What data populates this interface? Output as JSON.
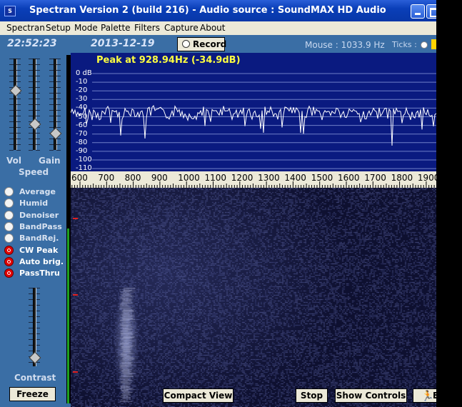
{
  "window": {
    "title": "Spectran Version 2 (build 216) - Audio source  :  SoundMAX HD Audio",
    "app_icon": "spectran-app-icon"
  },
  "menu": [
    "Spectran",
    "Setup",
    "Mode",
    "Palette",
    "Filters",
    "Capture",
    "About"
  ],
  "info": {
    "clock": "22:52:23",
    "date": "2013-12-19",
    "record_label": "Record",
    "mouse": "Mouse :  1033.9 Hz",
    "ticks": "Ticks :"
  },
  "left_panel": {
    "vol_label": "Vol",
    "gain_label": "Gain",
    "speed_label": "Speed",
    "contrast_label": "Contrast",
    "freeze_label": "Freeze",
    "options": [
      {
        "label": "Average",
        "on": false
      },
      {
        "label": "Humid",
        "on": false
      },
      {
        "label": "Denoiser",
        "on": false
      },
      {
        "label": "BandPass",
        "on": false
      },
      {
        "label": "BandRej.",
        "on": false
      },
      {
        "label": "CW Peak",
        "on": true
      },
      {
        "label": "Auto brig.",
        "on": true
      },
      {
        "label": "PassThru",
        "on": true
      }
    ]
  },
  "spectrum": {
    "peak_text": "Peak at   928.94Hz (-34.9dB)",
    "db_labels": [
      "0 dB",
      "-10",
      "-20",
      "-30",
      "-40",
      "-50",
      "-60",
      "-70",
      "-80",
      "-90",
      "-100",
      "-110"
    ],
    "freq_labels": [
      "600",
      "700",
      "800",
      "900",
      "1000",
      "1100",
      "1200",
      "1300",
      "1400",
      "1500",
      "1600",
      "1700",
      "1800",
      "1900"
    ]
  },
  "buttons": {
    "compact_view": "Compact View",
    "stop": "Stop",
    "show_controls": "Show Controls",
    "exit_cut": "E"
  },
  "colors": {
    "background": "#3a6ea5",
    "spectrum_bg": "#0a1a80",
    "peak_text": "#ffff40",
    "option_on": "#e00000"
  }
}
